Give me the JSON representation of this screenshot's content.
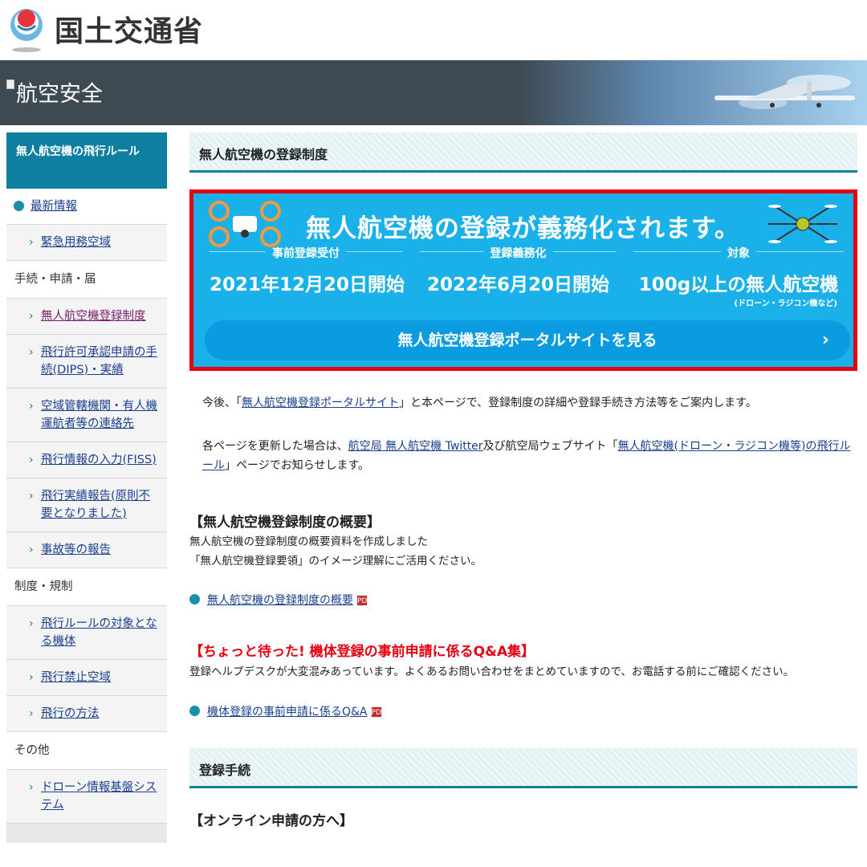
{
  "header": {
    "logo_text": "国土交通省"
  },
  "banner": {
    "title": "航空安全"
  },
  "sidebar": {
    "heading": "無人航空機の飛行ルール",
    "items": [
      {
        "type": "top",
        "label": "最新情報"
      },
      {
        "type": "link",
        "label": "緊急用務空域"
      },
      {
        "type": "cat",
        "label": "手続・申請・届"
      },
      {
        "type": "link",
        "label": "無人航空機登録制度",
        "active": true
      },
      {
        "type": "link",
        "label": "飛行許可承認申請の手続(DIPS)・実績"
      },
      {
        "type": "link",
        "label": "空域管轄機関・有人機運航者等の連絡先"
      },
      {
        "type": "link",
        "label": "飛行情報の入力(FISS)"
      },
      {
        "type": "link",
        "label": "飛行実績報告(原則不要となりました)"
      },
      {
        "type": "link",
        "label": "事故等の報告"
      },
      {
        "type": "cat",
        "label": "制度・規制"
      },
      {
        "type": "link",
        "label": "飛行ルールの対象となる機体"
      },
      {
        "type": "link",
        "label": "飛行禁止空域"
      },
      {
        "type": "link",
        "label": "飛行の方法"
      },
      {
        "type": "cat",
        "label": "その他"
      },
      {
        "type": "link",
        "label": "ドローン情報基盤システム"
      }
    ]
  },
  "main": {
    "section1_title": "無人航空機の登録制度",
    "promo": {
      "title": "無人航空機の登録が義務化されます。",
      "col1_label": "事前登録受付",
      "col1_value": "2021年12月20日開始",
      "col2_label": "登録義務化",
      "col2_value": "2022年6月20日開始",
      "col3_label": "対象",
      "col3_value": "100g以上の無人航空機",
      "col3_sub": "(ドローン・ラジコン機など)",
      "cta": "無人航空機登録ポータルサイトを見る"
    },
    "intro1_pre": "今後、「",
    "intro1_link": "無人航空機登録ポータルサイト",
    "intro1_post": "」と本ページで、登録制度の詳細や登録手続き方法等をご案内します。",
    "intro2_pre": "各ページを更新した場合は、",
    "intro2_link1": "航空局 無人航空機 Twitter",
    "intro2_mid": "及び航空局ウェブサイト「",
    "intro2_link2": "無人航空機(ドローン・ラジコン機等)の飛行ルール",
    "intro2_post": "」ページでお知らせします。",
    "overview_heading": "【無人航空機登録制度の概要】",
    "overview_line1": "無人航空機の登録制度の概要資料を作成しました",
    "overview_line2": "「無人航空機登録要領」のイメージ理解にご活用ください。",
    "overview_link": "無人航空機の登録制度の概要",
    "qa_heading": "【ちょっと待った! 機体登録の事前申請に係るQ&A集】",
    "qa_text": "登録ヘルプデスクが大変混みあっています。よくあるお問い合わせをまとめていますので、お電話する前にご確認ください。",
    "qa_link": "機体登録の事前申請に係るQ&A",
    "section2_title": "登録手続",
    "online_heading": "【オンライン申請の方へ】",
    "pdf_label": "PDF"
  },
  "colors": {
    "teal": "#0e7fa0",
    "promo_blue": "#1ab0ea",
    "alert_red": "#e60012"
  }
}
